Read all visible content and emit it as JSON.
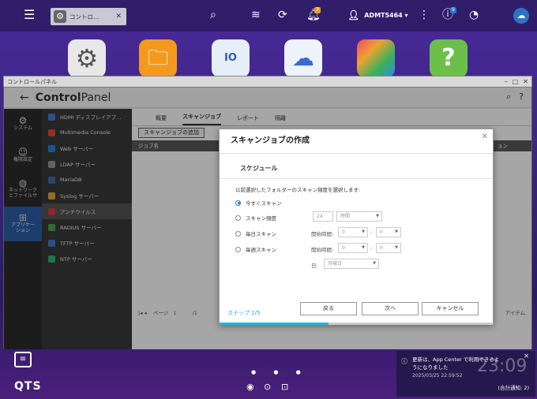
{
  "topbar": {
    "task_label": "コントロ…",
    "user_name": "ADMT5464 ▾",
    "notif_badge": "7",
    "info_badge": "9"
  },
  "window": {
    "title": "コントロールパネル",
    "header_title_bold": "Control",
    "header_title_light": "Panel",
    "left_nav": [
      {
        "label": "システム",
        "icon": "gear-icon"
      },
      {
        "label": "権限設定",
        "icon": "user-icon"
      },
      {
        "label": "ネットワーク\nとファイルサ",
        "icon": "globe-icon"
      },
      {
        "label": "アプリケー\nション",
        "icon": "apps-icon"
      }
    ],
    "sub_nav": [
      {
        "label": "HDMI ディスプレイアプ…",
        "color": "#3b7fd1"
      },
      {
        "label": "Multimedia Console",
        "color": "#e04a2a"
      },
      {
        "label": "Web サーバー",
        "color": "#1e88e5"
      },
      {
        "label": "LDAP サーバー",
        "color": "#999999"
      },
      {
        "label": "MariaDB",
        "color": "#3a6ea5"
      },
      {
        "label": "Syslog サーバー",
        "color": "#e8a33a"
      },
      {
        "label": "アンチウイルス",
        "color": "#d94040"
      },
      {
        "label": "RADIUS サーバー",
        "color": "#47a847"
      },
      {
        "label": "TFTP サーバー",
        "color": "#3b7fd1"
      },
      {
        "label": "NTP サーバー",
        "color": "#2bb673"
      }
    ],
    "tabs": [
      "概要",
      "スキャンジョブ",
      "レポート",
      "隔離"
    ],
    "add_button": "スキャンジョブの追加",
    "table_header": "ジョブ名",
    "table_header_right": "ョン",
    "pager_label": "ページ",
    "pager_value": "1",
    "pager_of": "/1",
    "item_label": "アイテム"
  },
  "dialog": {
    "title": "スキャンジョブの作成",
    "section": "スケジュール",
    "description": "以前選択したフォルダーのスキャン頻度を選択します:",
    "options": [
      "今すぐスキャン",
      "スキャン頻度",
      "毎日スキャン",
      "毎週スキャン"
    ],
    "freq_value": "24",
    "freq_unit": "時間",
    "start_time_label": "開始時間:",
    "hour": "0",
    "minute": "0",
    "day_label": "日:",
    "day_value": "月曜日",
    "step": "ステップ 2/5",
    "back": "戻る",
    "next": "次へ",
    "cancel": "キャンセル",
    "progress": 0.4
  },
  "notification": {
    "text": "更新は、App Center で利用できるよ\nうになりました",
    "time": "2025/03/25 22:59:52",
    "total": "(合計通知: 2)",
    "clock": "23:09",
    "date": "2025/..."
  },
  "logo": "QTS"
}
